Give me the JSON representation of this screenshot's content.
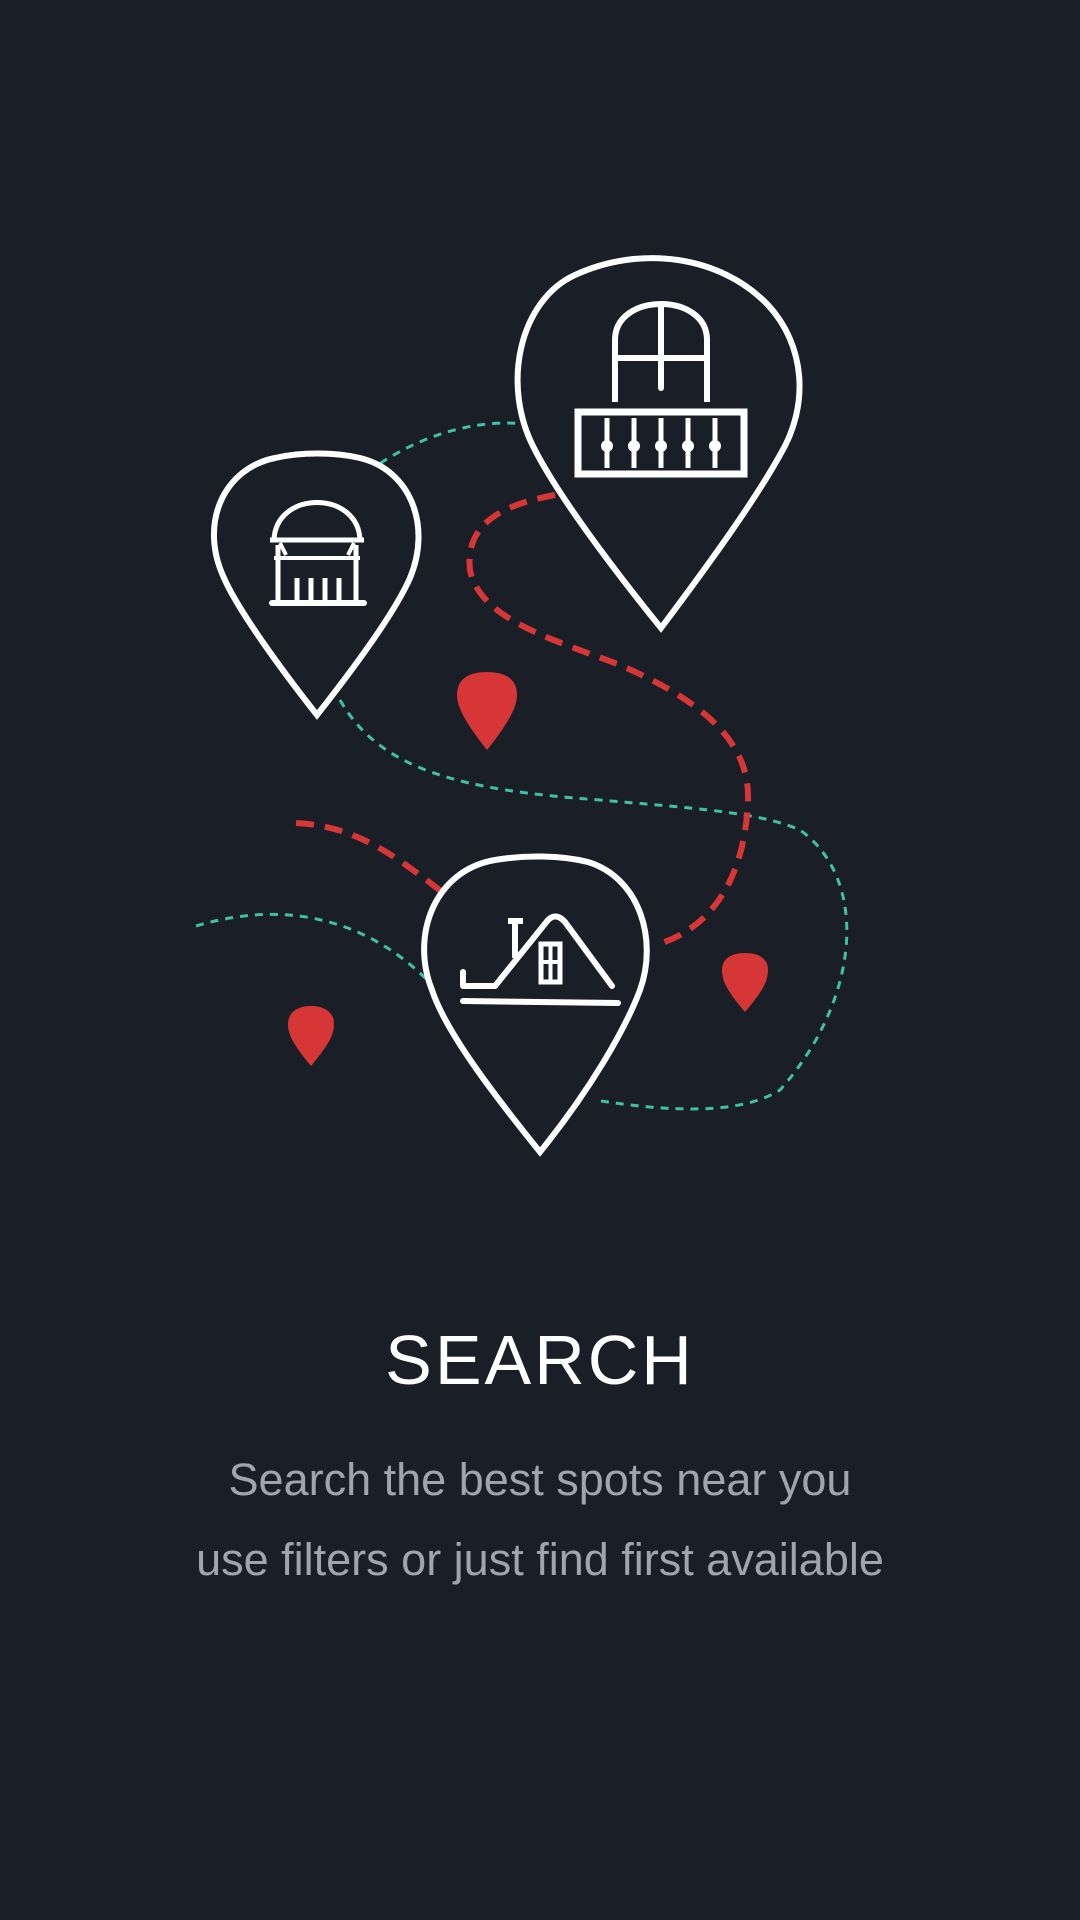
{
  "onboarding": {
    "title": "SEARCH",
    "description_line1": "Search the best spots near you",
    "description_line2": "use filters or just find first available"
  },
  "colors": {
    "background": "#1a1e27",
    "pin_outline": "#ffffff",
    "route_red": "#d63636",
    "route_teal": "#40c0a8",
    "description_text": "#a0a4ac"
  },
  "icons": [
    "large-pin-balcony-icon",
    "medium-pin-gazebo-icon",
    "pin-house-icon",
    "small-red-pin-icon"
  ]
}
